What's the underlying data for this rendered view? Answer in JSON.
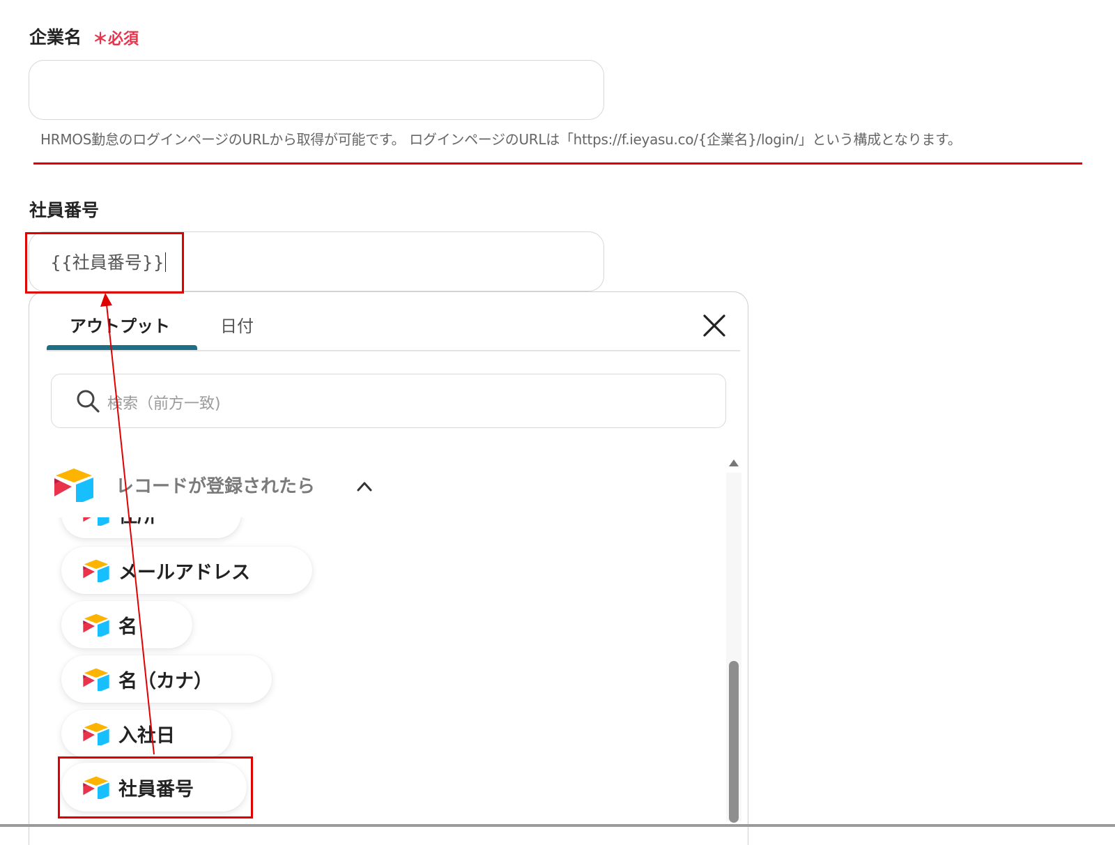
{
  "company_field": {
    "label": "企業名",
    "required_mark": "＊",
    "required_text": "必須",
    "value": "",
    "help_text": "HRMOS勤怠のログインページのURLから取得が可能です。 ログインページのURLは「https://f.ieyasu.co/{企業名}/login/」という構成となります。"
  },
  "employee_field": {
    "label": "社員番号",
    "value": "{{社員番号}}"
  },
  "dropdown": {
    "tabs": [
      {
        "label": "アウトプット",
        "active": true
      },
      {
        "label": "日付",
        "active": false
      }
    ],
    "close_icon": "close-icon",
    "search": {
      "placeholder": "検索（前方一致)",
      "icon": "search-icon"
    },
    "group": {
      "title": "レコードが登録されたら",
      "icon": "airtable-logo-icon",
      "toggle_icon": "chevron-up-icon"
    },
    "items": [
      {
        "label": "住所"
      },
      {
        "label": "メールアドレス"
      },
      {
        "label": "名"
      },
      {
        "label": "名（カナ）"
      },
      {
        "label": "入社日"
      },
      {
        "label": "社員番号"
      }
    ]
  },
  "colors": {
    "required": "#e8334a",
    "tab_underline": "#1d6f86",
    "annotation_red": "#e00000"
  }
}
